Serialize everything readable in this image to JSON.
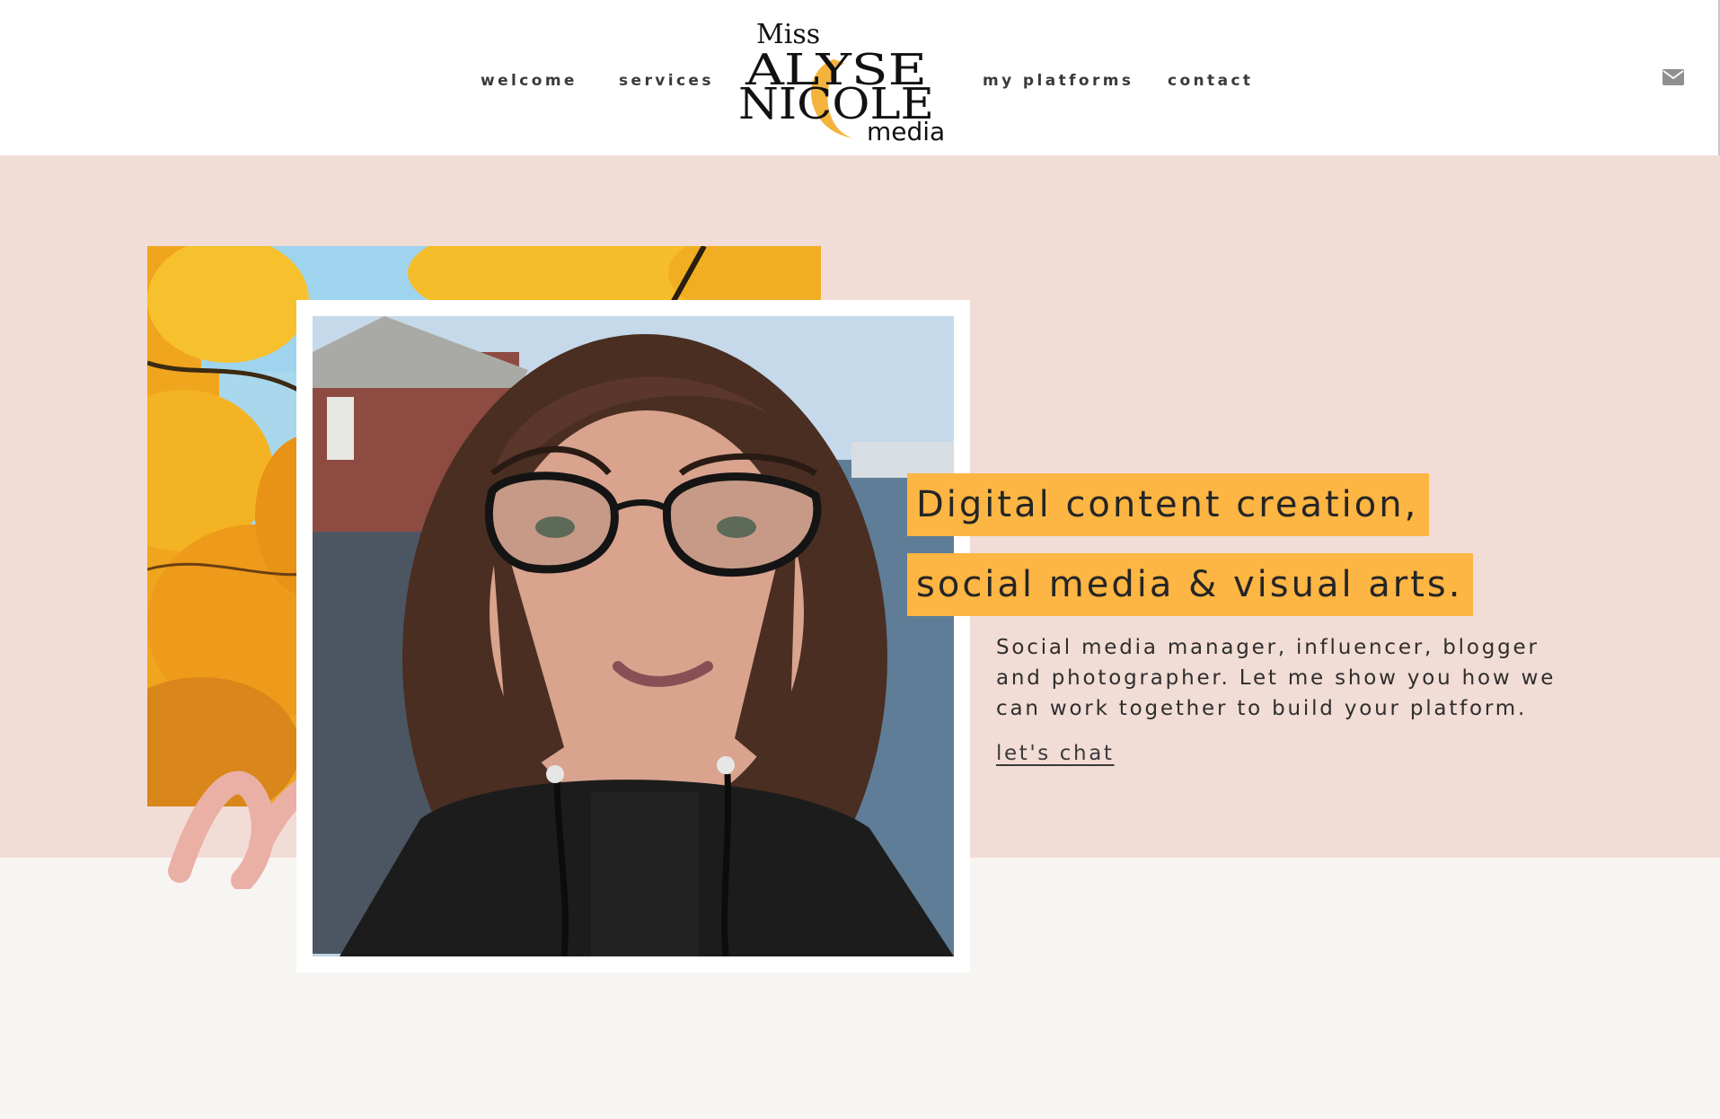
{
  "colors": {
    "header_bg": "#ffffff",
    "hero_bg": "#f2dcd6",
    "page_bg": "#f6f5f2",
    "highlight": "#fdb543",
    "logo_accent": "#f3b33d",
    "text": "#2b2b2b"
  },
  "nav": {
    "items": [
      {
        "label": "welcome"
      },
      {
        "label": "services"
      },
      {
        "label": "my platforms"
      },
      {
        "label": "contact"
      }
    ]
  },
  "logo": {
    "line1": "Miss",
    "line2": "ALYSE",
    "line3": "NICOLE",
    "line4": "media"
  },
  "header": {
    "mail_icon": "envelope-icon"
  },
  "hero": {
    "headline_line1": "Digital content creation,",
    "headline_line2": "social media & visual arts.",
    "description": "Social media manager, influencer, blogger and photographer. Let me show you how we can work together to build your platform.",
    "cta_label": "let's chat"
  }
}
